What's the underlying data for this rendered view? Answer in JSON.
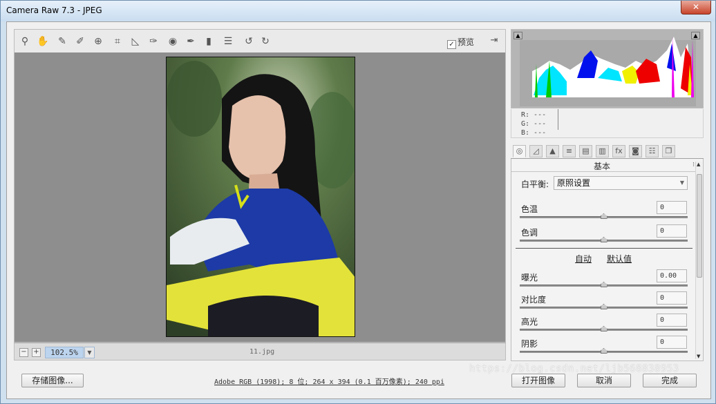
{
  "window": {
    "title": "Camera Raw 7.3 -  JPEG"
  },
  "toolbar": {
    "tools": [
      {
        "name": "zoom-tool-icon",
        "glyph": "⚲"
      },
      {
        "name": "hand-tool-icon",
        "glyph": "✋"
      },
      {
        "name": "white-balance-tool-icon",
        "glyph": "✎"
      },
      {
        "name": "color-sampler-tool-icon",
        "glyph": "✐"
      },
      {
        "name": "target-adjustment-tool-icon",
        "glyph": "⊕"
      },
      {
        "name": "crop-tool-icon",
        "glyph": "⌗"
      },
      {
        "name": "straighten-tool-icon",
        "glyph": "◺"
      },
      {
        "name": "spot-removal-tool-icon",
        "glyph": "✑"
      },
      {
        "name": "red-eye-removal-icon",
        "glyph": "◉"
      },
      {
        "name": "adjustment-brush-icon",
        "glyph": "✒"
      },
      {
        "name": "graduated-filter-icon",
        "glyph": "▮"
      },
      {
        "name": "preferences-icon",
        "glyph": "☰"
      },
      {
        "name": "rotate-ccw-icon",
        "glyph": "↺"
      },
      {
        "name": "rotate-cw-icon",
        "glyph": "↻"
      }
    ],
    "preview_label": "预览",
    "preview_checked": true,
    "fullscreen_glyph": "⇥"
  },
  "statusbar": {
    "zoom_out": "−",
    "zoom_in": "+",
    "zoom_value": "102.5%",
    "filename": "11.jpg"
  },
  "histogram": {
    "shadow_clip": "▲",
    "highlight_clip": "▲",
    "readout": {
      "r": "R:  ---",
      "g": "G:  ---",
      "b": "B:  ---"
    }
  },
  "tabs": [
    {
      "name": "tab-basic-icon",
      "glyph": "◎",
      "active": true
    },
    {
      "name": "tab-tone-curve-icon",
      "glyph": "◿"
    },
    {
      "name": "tab-detail-icon",
      "glyph": "▲"
    },
    {
      "name": "tab-hsl-icon",
      "glyph": "≡"
    },
    {
      "name": "tab-split-toning-icon",
      "glyph": "▤"
    },
    {
      "name": "tab-lens-corrections-icon",
      "glyph": "▥"
    },
    {
      "name": "tab-effects-icon",
      "glyph": "fx"
    },
    {
      "name": "tab-camera-calibration-icon",
      "glyph": "◙"
    },
    {
      "name": "tab-presets-icon",
      "glyph": "☷"
    },
    {
      "name": "tab-snapshots-icon",
      "glyph": "❐"
    }
  ],
  "panel": {
    "title": "基本",
    "menu_glyph": "⁝≡",
    "white_balance": {
      "label": "白平衡:",
      "value": "原照设置"
    },
    "sliders_top": [
      {
        "label": "色温",
        "value": "0",
        "pos": 0.5
      },
      {
        "label": "色调",
        "value": "0",
        "pos": 0.5
      }
    ],
    "auto_label": "自动",
    "default_label": "默认值",
    "sliders_bottom": [
      {
        "label": "曝光",
        "value": "0.00",
        "pos": 0.5
      },
      {
        "label": "对比度",
        "value": "0",
        "pos": 0.5
      },
      {
        "label": "高光",
        "value": "0",
        "pos": 0.5
      },
      {
        "label": "阴影",
        "value": "0",
        "pos": 0.5
      }
    ]
  },
  "bottom": {
    "save_label": "存储图像...",
    "info_text": "Adobe RGB (1998); 8 位; 264 x 394 (0.1 百万像素); 240 ppi",
    "open_label": "打开图像",
    "cancel_label": "取消",
    "done_label": "完成"
  },
  "watermark": "https://blog.csdn.net/ljb568838953",
  "colors": {
    "accent_field": "#bcd4ee",
    "canvas_bg": "#8e8e8e",
    "histogram_bg": "#b9b9b9"
  }
}
